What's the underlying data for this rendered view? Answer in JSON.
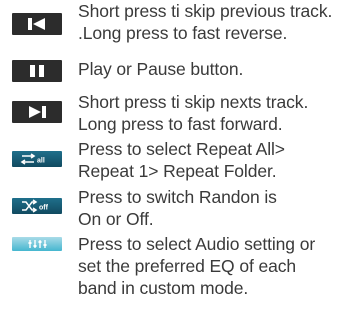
{
  "rows": [
    {
      "icon": "skip-previous-icon",
      "lines": [
        "Short press ti skip previous track.",
        ".Long press to fast reverse."
      ]
    },
    {
      "icon": "play-pause-icon",
      "lines": [
        "Play or Pause button."
      ]
    },
    {
      "icon": "skip-next-icon",
      "lines": [
        "Short press ti skip nexts track.",
        "Long press to fast forward."
      ]
    },
    {
      "icon": "repeat-all-icon",
      "icon_text": "all",
      "lines": [
        "Press to select Repeat All>",
        "Repeat 1> Repeat Folder."
      ]
    },
    {
      "icon": "shuffle-off-icon",
      "icon_text": "off",
      "lines": [
        "Press to switch Randon is",
        "On or Off."
      ]
    },
    {
      "icon": "equalizer-icon",
      "lines": [
        "Press to select Audio setting or",
        "set the preferred EQ of each",
        "band in custom mode."
      ]
    }
  ],
  "colors": {
    "text": "#3a3a3a",
    "icon_dark": "#2c2c2c",
    "icon_blue": "#1f6f8b",
    "icon_eq": "#45b6cf"
  }
}
